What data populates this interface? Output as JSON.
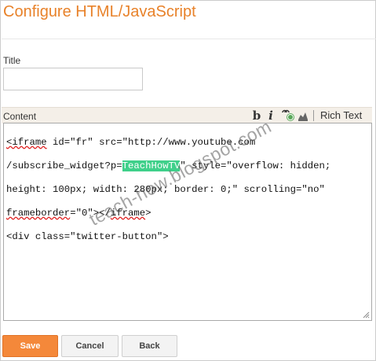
{
  "dialog": {
    "title": "Configure HTML/JavaScript"
  },
  "form": {
    "title_label": "Title",
    "title_value": "",
    "content_label": "Content"
  },
  "toolbar": {
    "bold_label": "b",
    "italic_label": "i",
    "rich_text_label": "Rich Text",
    "icons": [
      "bold-icon",
      "italic-icon",
      "link-icon",
      "image-icon"
    ]
  },
  "editor": {
    "lines": [
      {
        "pre": "",
        "word1": "<iframe",
        "post": " id=\"fr\" src=\"http://www.youtube.com"
      },
      {
        "pre": "/subscribe_widget?p=",
        "highlight": "TeachHowTV",
        "post": "\" style=\"overflow: hidden;"
      },
      {
        "pre": "height: 100px; width: 280px; border: 0;\" scrolling=\"no\""
      },
      {
        "word1": "frameborder",
        "mid": "=\"0\"></",
        "word2": "iframe",
        "post": ">"
      },
      {
        "pre": "<div class=\"twitter-button\">"
      }
    ]
  },
  "watermark": {
    "text": "teach-how.blogspot.com"
  },
  "buttons": {
    "save": "Save",
    "cancel": "Cancel",
    "back": "Back"
  },
  "colors": {
    "title_orange": "#e8822a",
    "save_orange": "#f4883a",
    "highlight_green": "#3fd08a"
  }
}
